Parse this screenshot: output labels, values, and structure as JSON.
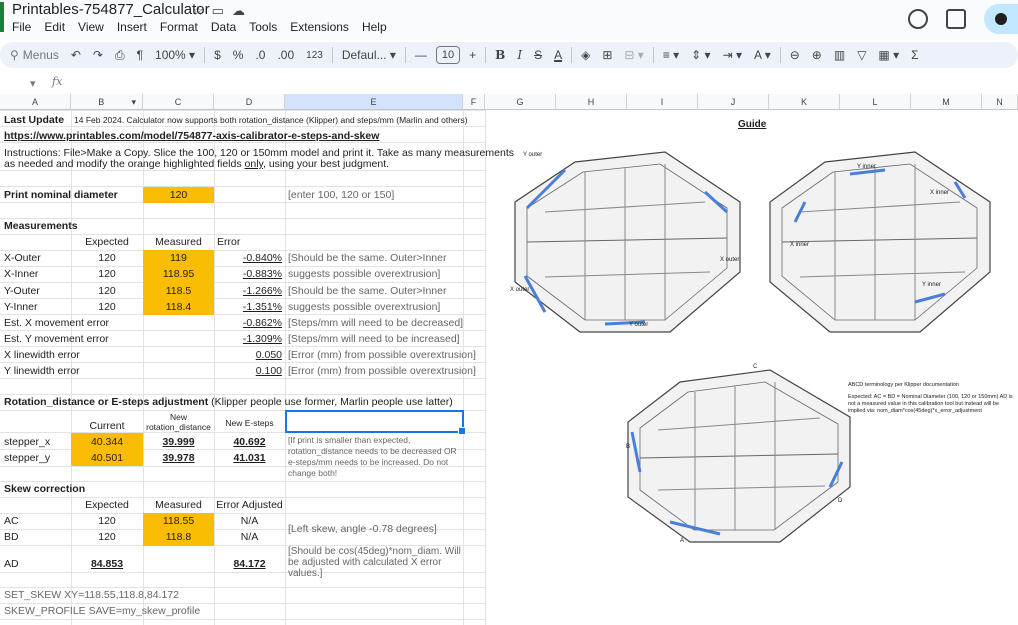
{
  "doc": {
    "title": "Printables-754877_Calculator"
  },
  "menu": [
    "File",
    "Edit",
    "View",
    "Insert",
    "Format",
    "Data",
    "Tools",
    "Extensions",
    "Help"
  ],
  "toolbar": {
    "menus": "Menus",
    "zoom": "100%",
    "currency": "$",
    "percent": "%",
    "dec_less": ".0",
    "dec_more": ".00",
    "number_format": "123",
    "font": "Defaul...",
    "font_size": "10",
    "bold": "B",
    "italic": "I",
    "strike": "S",
    "text_color": "A",
    "sum": "Σ"
  },
  "formula_bar": {
    "fx": "fx"
  },
  "columns": [
    "A",
    "B",
    "C",
    "D",
    "E",
    "F",
    "G",
    "H",
    "I",
    "J",
    "K",
    "L",
    "M",
    "N"
  ],
  "rows": {
    "r1": {
      "label": "Last Update",
      "text": "14 Feb 2024. Calculator now supports both rotation_distance (Klipper) and steps/mm (Marlin and others)"
    },
    "r2": {
      "link": "https://www.printables.com/model/754877-axis-calibrator-e-steps-and-skew"
    },
    "r3": {
      "line1": "Instructions: File>Make a Copy. Slice the 100, 120 or 150mm model and print it. Take as many measurements",
      "line2a": "as needed and modify the orange highlighted fields ",
      "line2b": "only",
      "line2c": ", using your best judgment."
    },
    "print_nominal": {
      "label": "Print nominal diameter",
      "value": "120",
      "hint": "[enter 100, 120 or 150]"
    },
    "measurements": {
      "heading": "Measurements",
      "h_expected": "Expected",
      "h_measured": "Measured",
      "h_error": "Error"
    },
    "m_rows": [
      {
        "label": "X-Outer",
        "expected": "120",
        "measured": "119",
        "error": "-0.840%",
        "note": "[Should be the same. Outer>Inner"
      },
      {
        "label": "X-Inner",
        "expected": "120",
        "measured": "118.95",
        "error": "-0.883%",
        "note": "suggests possible overextrusion]"
      },
      {
        "label": "Y-Outer",
        "expected": "120",
        "measured": "118.5",
        "error": "-1.266%",
        "note": "[Should be the same. Outer>Inner"
      },
      {
        "label": "Y-Inner",
        "expected": "120",
        "measured": "118.4",
        "error": "-1.351%",
        "note": "suggests possible overextrusion]"
      }
    ],
    "e_rows": [
      {
        "label": "Est. X movement error",
        "value": "-0.862%",
        "note": "[Steps/mm will need to be decreased]"
      },
      {
        "label": "Est. Y movement error",
        "value": "-1.309%",
        "note": "[Steps/mm will need to be increased]"
      },
      {
        "label": "X linewidth error",
        "value": "0.050",
        "note": "[Error (mm) from possible overextrusion]"
      },
      {
        "label": "Y linewidth error",
        "value": "0.100",
        "note": "[Error (mm) from possible overextrusion]"
      }
    ],
    "rot": {
      "heading_bold": "Rotation_distance or E-steps adjustment",
      "heading_rest": " (Klipper people use former, Marlin people use latter)",
      "h_current": "Current",
      "h_new_rot_1": "New",
      "h_new_rot_2": "rotation_distance",
      "h_new_esteps": "New E-steps"
    },
    "stepper": [
      {
        "label": "stepper_x",
        "current": "40.344",
        "new_rot": "39.999",
        "new_esteps": "40.692"
      },
      {
        "label": "stepper_y",
        "current": "40.501",
        "new_rot": "39.978",
        "new_esteps": "41.031"
      }
    ],
    "stepper_note": "[If print is smaller than expected, rotation_distance needs to be decreased OR e-steps/mm needs to be increased. Do not change both!",
    "skew": {
      "heading": "Skew correction",
      "h_expected": "Expected",
      "h_measured": "Measured",
      "h_error": "Error Adjusted"
    },
    "skew_rows": [
      {
        "label": "AC",
        "expected": "120",
        "measured": "118.55",
        "adjusted": "N/A"
      },
      {
        "label": "BD",
        "expected": "120",
        "measured": "118.8",
        "adjusted": "N/A"
      },
      {
        "label": "AD",
        "expected": "84.853",
        "measured": "",
        "adjusted": "84.172"
      }
    ],
    "skew_note1": "[Left skew, angle -0.78 degrees]",
    "skew_note2": "[Should be cos(45deg)*nom_diam. Will be adjusted with calculated X error values.]",
    "set_skew": "SET_SKEW XY=118.55,118.8,84.172",
    "skew_profile": "SKEW_PROFILE SAVE=my_skew_profile"
  },
  "guide": {
    "title": "Guide",
    "labels1": {
      "y_outer_top": "Y outer",
      "x_outer_right": "X outer",
      "x_outer_left": "X outer",
      "y_outer_bottom": "Y outer"
    },
    "labels2": {
      "y_inner_top": "Y inner",
      "x_inner_right": "X inner",
      "x_inner_left": "X inner",
      "y_inner_bottom": "Y inner"
    },
    "labels3": {
      "a": "A",
      "b": "B",
      "c": "C",
      "d": "D"
    },
    "notes_title": "ABCD terminology per Klipper documentation",
    "notes_body": "Expected: AC = BD = Nominal Diameter (100, 120 or 150mm) AD is not a measured value in this calibration tool but instead will be implied via: nom_diam*cos(45deg)*x_error_adjustment"
  },
  "colors": {
    "orange": "#fbbc04",
    "selection": "#1a73e8",
    "highlight_edge": "#4a7fd9"
  }
}
